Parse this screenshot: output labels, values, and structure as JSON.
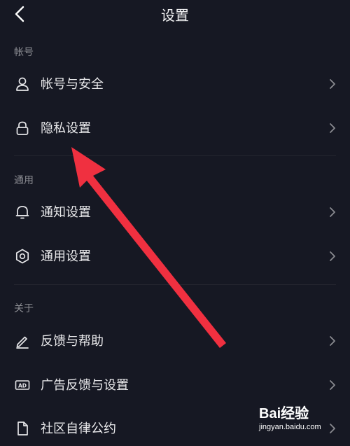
{
  "header": {
    "title": "设置"
  },
  "sections": {
    "account": {
      "label": "帐号",
      "items": [
        {
          "label": "帐号与安全",
          "icon": "user-icon"
        },
        {
          "label": "隐私设置",
          "icon": "lock-icon"
        }
      ]
    },
    "general": {
      "label": "通用",
      "items": [
        {
          "label": "通知设置",
          "icon": "bell-icon"
        },
        {
          "label": "通用设置",
          "icon": "gear-icon"
        }
      ]
    },
    "about": {
      "label": "关于",
      "items": [
        {
          "label": "反馈与帮助",
          "icon": "pencil-icon"
        },
        {
          "label": "广告反馈与设置",
          "icon": "ad-icon"
        },
        {
          "label": "社区自律公约",
          "icon": "document-icon"
        }
      ]
    }
  },
  "watermark": {
    "brand": "Bai经验",
    "url": "jingyan.baidu.com"
  },
  "colors": {
    "background": "#161823",
    "annotation_arrow": "#f03040"
  }
}
